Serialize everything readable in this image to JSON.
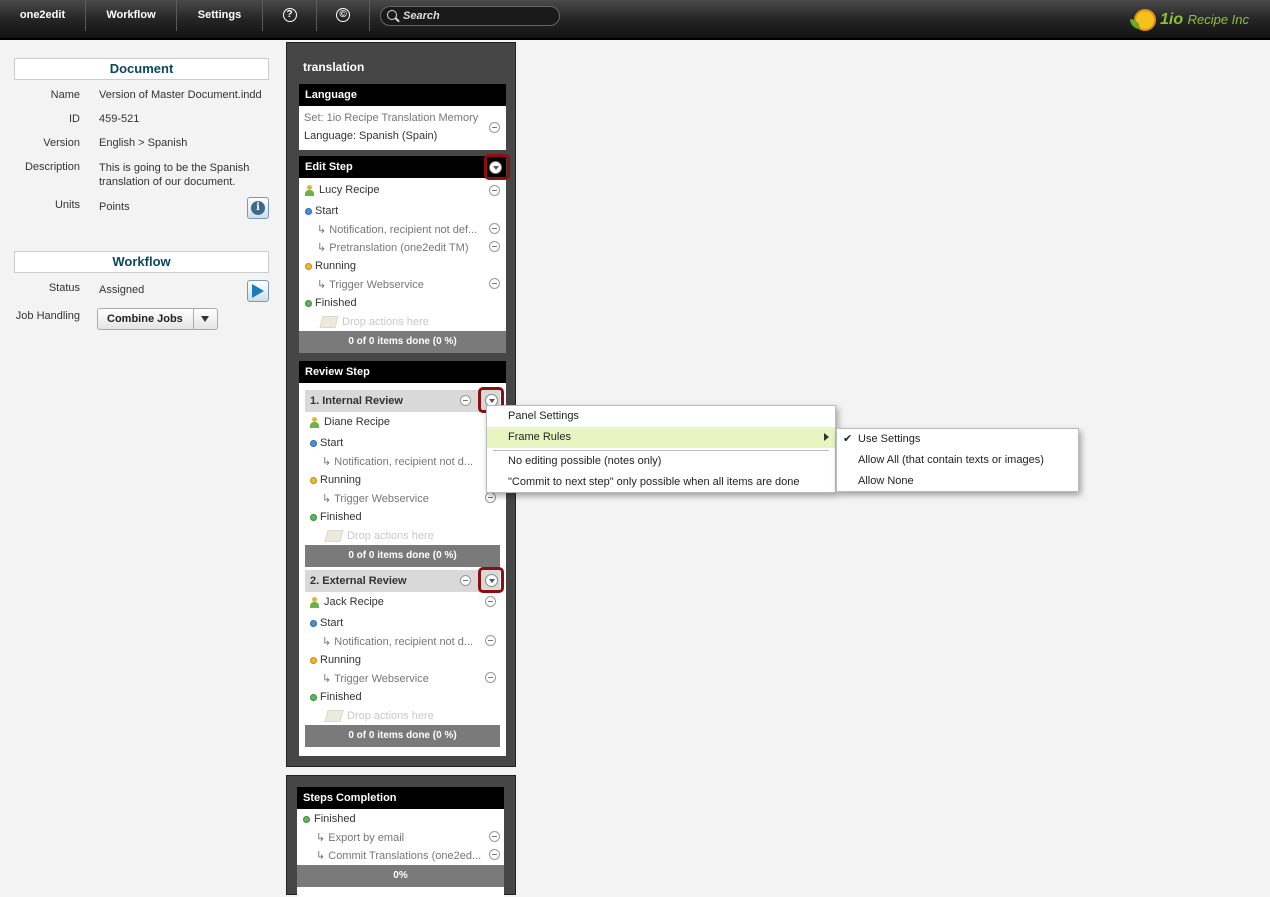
{
  "topbar": {
    "items": [
      "one2edit",
      "Workflow",
      "Settings"
    ],
    "help_glyph": "?",
    "copyright_glyph": "©",
    "search_placeholder": "Search",
    "logo_text": "1io",
    "logo_subtext": "Recipe Inc"
  },
  "document": {
    "title": "Document",
    "fields": [
      {
        "label": "Name",
        "value": "Version of Master Document.indd"
      },
      {
        "label": "ID",
        "value": "459-521"
      },
      {
        "label": "Version",
        "value": "English > Spanish"
      },
      {
        "label": "Description",
        "value": "This is going to be the Spanish translation of our document."
      },
      {
        "label": "Units",
        "value": "Points"
      }
    ],
    "info_glyph": "i"
  },
  "workflow": {
    "title": "Workflow",
    "status_label": "Status",
    "status_value": "Assigned",
    "job_handling_label": "Job Handling",
    "job_handling_value": "Combine Jobs"
  },
  "translation": {
    "title": "translation",
    "language": {
      "header": "Language",
      "set": "Set: 1io Recipe Translation Memory",
      "language": "Language: Spanish (Spain)"
    },
    "edit_step": {
      "header": "Edit Step",
      "user": "Lucy Recipe",
      "start": "Start",
      "start_actions": [
        "Notification, recipient not def...",
        "Pretranslation (one2edit TM)"
      ],
      "running": "Running",
      "running_actions": [
        "Trigger Webservice"
      ],
      "finished": "Finished",
      "drop": "Drop actions here",
      "progress": "0 of 0 items done (0 %)"
    },
    "review_step": {
      "header": "Review Step",
      "reviews": [
        {
          "title": "1. Internal Review",
          "user": "Diane Recipe",
          "start": "Start",
          "start_action": "Notification, recipient not d...",
          "running": "Running",
          "running_action": "Trigger Webservice",
          "finished": "Finished",
          "drop": "Drop actions here",
          "progress": "0 of 0 items done (0 %)"
        },
        {
          "title": "2. External Review",
          "user": "Jack Recipe",
          "start": "Start",
          "start_action": "Notification, recipient not d...",
          "running": "Running",
          "running_action": "Trigger Webservice",
          "finished": "Finished",
          "drop": "Drop actions here",
          "progress": "0 of 0 items done (0 %)"
        }
      ]
    }
  },
  "steps_completion": {
    "header": "Steps Completion",
    "finished": "Finished",
    "actions": [
      "Export by email",
      "Commit Translations (one2ed..."
    ],
    "progress": "0%"
  },
  "context_menu": {
    "items": [
      "Panel Settings",
      "Frame Rules",
      "No editing possible (notes only)",
      "\"Commit to next step\" only possible when all items are done"
    ],
    "active_item": "Frame Rules"
  },
  "submenu": {
    "items": [
      "Use Settings",
      "Allow All (that contain texts or images)",
      "Allow None"
    ],
    "checked": "Use Settings",
    "check_glyph": "✔"
  }
}
